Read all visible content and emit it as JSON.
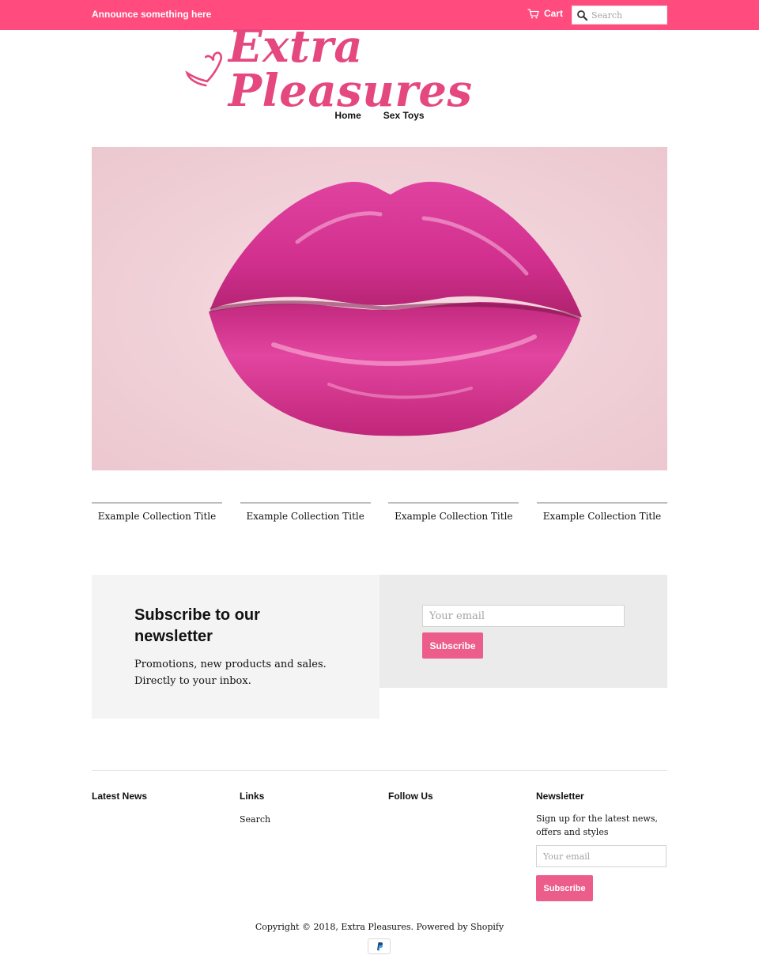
{
  "colors": {
    "announcement_bar": "#ff4b7d",
    "brand_pink": "#e5477f",
    "button_pink": "#ec5d8b"
  },
  "header": {
    "announcement": "Announce something here",
    "cart_label": "Cart",
    "cart_icon": "cart-icon",
    "search_icon": "search-icon",
    "search_placeholder": "Search"
  },
  "logo": {
    "text": "Extra Pleasures",
    "icon": "heart-icon"
  },
  "nav": {
    "items": [
      {
        "label": "Home"
      },
      {
        "label": "Sex Toys"
      }
    ]
  },
  "hero": {
    "image": "pink-glossy-lips-photo"
  },
  "collections": [
    {
      "title": "Example Collection Title"
    },
    {
      "title": "Example Collection Title"
    },
    {
      "title": "Example Collection Title"
    },
    {
      "title": "Example Collection Title"
    }
  ],
  "newsletter_section": {
    "heading": "Subscribe to our newsletter",
    "text": "Promotions, new products and sales. Directly to your inbox.",
    "email_placeholder": "Your email",
    "button_label": "Subscribe"
  },
  "footer": {
    "latest_news_heading": "Latest News",
    "links_heading": "Links",
    "links": [
      {
        "label": "Search"
      }
    ],
    "follow_heading": "Follow Us",
    "newsletter_heading": "Newsletter",
    "newsletter_text": "Sign up for the latest news, offers and styles",
    "email_placeholder": "Your email",
    "button_label": "Subscribe",
    "copyright": "Copyright © 2018, Extra Pleasures. Powered by Shopify",
    "payment_icon": "paypal-icon"
  }
}
